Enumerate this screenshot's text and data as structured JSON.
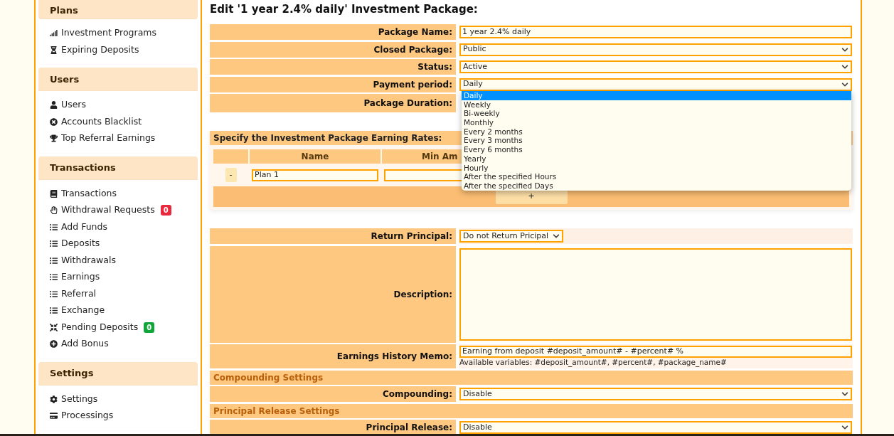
{
  "sidebar": [
    {
      "title": "Plans",
      "items": [
        {
          "label": "Investment Programs"
        },
        {
          "label": "Expiring Deposits"
        }
      ]
    },
    {
      "title": "Users",
      "items": [
        {
          "label": "Users"
        },
        {
          "label": "Accounts Blacklist"
        },
        {
          "label": "Top Referral Earnings"
        }
      ]
    },
    {
      "title": "Transactions",
      "items": [
        {
          "label": "Transactions"
        },
        {
          "label": "Withdrawal Requests",
          "badge": "0",
          "color": "#e8283d"
        },
        {
          "label": "Add Funds"
        },
        {
          "label": "Deposits"
        },
        {
          "label": "Withdrawals"
        },
        {
          "label": "Earnings"
        },
        {
          "label": "Referral"
        },
        {
          "label": "Exchange"
        },
        {
          "label": "Pending Deposits",
          "badge": "0",
          "color": "#12a53a"
        },
        {
          "label": "Add Bonus"
        }
      ]
    },
    {
      "title": "Settings",
      "items": [
        {
          "label": "Settings"
        },
        {
          "label": "Processings"
        }
      ]
    }
  ],
  "title": "Edit '1 year 2.4% daily' Investment Package:",
  "fields": [
    {
      "kind": "input",
      "label": "Package Name:",
      "value": "1 year 2.4% daily"
    },
    {
      "kind": "select",
      "label": "Closed Package:",
      "value": "Public"
    },
    {
      "kind": "select",
      "label": "Status:",
      "value": "Active"
    },
    {
      "kind": "select",
      "label": "Payment period:",
      "value": "Daily",
      "expanded": true,
      "options": [
        {
          "label": "Daily",
          "selected": true
        },
        {
          "label": "Weekly",
          "selected": false
        },
        {
          "label": "Bi-weekly",
          "selected": false
        },
        {
          "label": "Monthly",
          "selected": false
        },
        {
          "label": "Every 2 months",
          "selected": false
        },
        {
          "label": "Every 3 months",
          "selected": false
        },
        {
          "label": "Every 6 months",
          "selected": false
        },
        {
          "label": "Yearly",
          "selected": false
        },
        {
          "label": "Hourly",
          "selected": false
        },
        {
          "label": "After the specified Hours",
          "selected": false
        },
        {
          "label": "After the specified Days",
          "selected": false
        }
      ]
    },
    {
      "kind": "hidden",
      "label": "Package Duration:"
    }
  ],
  "rates": {
    "title": "Specify the Investment Package Earning Rates:",
    "columns": [
      "Name",
      "Min Am"
    ],
    "rows": [
      {
        "remove": "-",
        "name": "Plan 1"
      }
    ],
    "add": "+"
  },
  "fields2": [
    {
      "kind": "small-select",
      "label": "Return Principal:",
      "value": "Do not Return Pricipal"
    },
    {
      "kind": "textarea",
      "label": "Description:"
    },
    {
      "kind": "memo",
      "label": "Earnings History Memo:",
      "value": "Earning from deposit #deposit_amount# - #percent# %",
      "hint": "Available variables: #deposit_amount#, #percent#, #package_name#"
    },
    {
      "kind": "section",
      "label": "Compounding Settings"
    },
    {
      "kind": "select",
      "label": "Compounding:",
      "value": "Disable"
    },
    {
      "kind": "section",
      "label": "Principal Release Settings"
    },
    {
      "kind": "select",
      "label": "Principal Release:",
      "value": "Disable"
    }
  ]
}
